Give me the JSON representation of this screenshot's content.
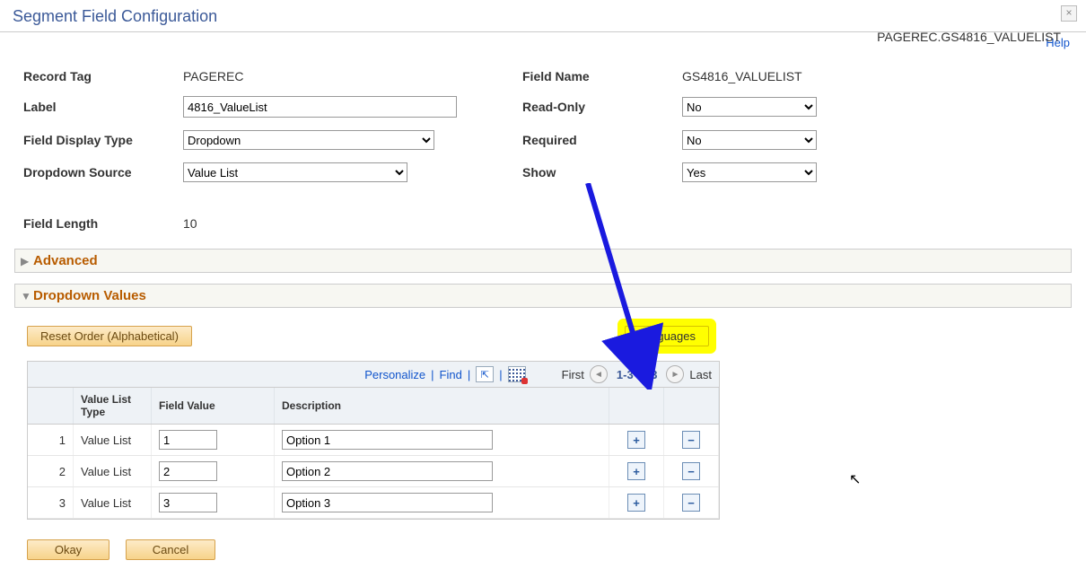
{
  "window": {
    "title": "Segment Field Configuration",
    "close": "×"
  },
  "help": {
    "label": "Help"
  },
  "breadcrumb": "PAGEREC.GS4816_VALUELIST",
  "fields": {
    "record_tag": {
      "label": "Record Tag",
      "value": "PAGEREC"
    },
    "label": {
      "label": "Label",
      "value": "4816_ValueList"
    },
    "field_display_type": {
      "label": "Field Display Type",
      "value": "Dropdown"
    },
    "dropdown_source": {
      "label": "Dropdown Source",
      "value": "Value List"
    },
    "field_length": {
      "label": "Field Length",
      "value": "10"
    },
    "field_name": {
      "label": "Field Name",
      "value": "GS4816_VALUELIST"
    },
    "read_only": {
      "label": "Read-Only",
      "value": "No"
    },
    "required": {
      "label": "Required",
      "value": "No"
    },
    "show": {
      "label": "Show",
      "value": "Yes"
    }
  },
  "sections": {
    "advanced": "Advanced",
    "dropdown_values": "Dropdown Values"
  },
  "buttons": {
    "reset_order": "Reset Order (Alphabetical)",
    "languages": "Languages",
    "okay": "Okay",
    "cancel": "Cancel"
  },
  "grid_toolbar": {
    "personalize": "Personalize",
    "find": "Find",
    "first": "First",
    "range": "1-3 of 3",
    "last": "Last"
  },
  "grid": {
    "headers": {
      "value_list_type": "Value List Type",
      "field_value": "Field Value",
      "description": "Description"
    },
    "rows": [
      {
        "n": "1",
        "type": "Value List",
        "value": "1",
        "desc": "Option 1"
      },
      {
        "n": "2",
        "type": "Value List",
        "value": "2",
        "desc": "Option 2"
      },
      {
        "n": "3",
        "type": "Value List",
        "value": "3",
        "desc": "Option 3"
      }
    ]
  }
}
